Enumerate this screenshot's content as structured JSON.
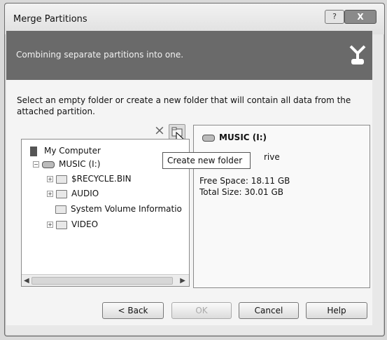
{
  "window": {
    "title": "Merge Partitions",
    "help_button": "?",
    "close_button": "X"
  },
  "banner": {
    "subtitle": "Combining separate partitions into one."
  },
  "instruction": "Select an empty folder or create a new folder that will contain all data from the attached partition.",
  "toolbar": {
    "delete_icon": "×",
    "tooltip": "Create new folder"
  },
  "tree": {
    "root": "My Computer",
    "drive": "MUSIC (I:)",
    "folders": [
      "$RECYCLE.BIN",
      "AUDIO",
      "System Volume Informatio",
      "VIDEO"
    ]
  },
  "details": {
    "title": "MUSIC (I:)",
    "type_visible": "rive",
    "free_space": "Free Space: 18.11 GB",
    "total_size": "Total Size: 30.01 GB"
  },
  "buttons": {
    "back": "< Back",
    "ok": "OK",
    "cancel": "Cancel",
    "help": "Help"
  }
}
